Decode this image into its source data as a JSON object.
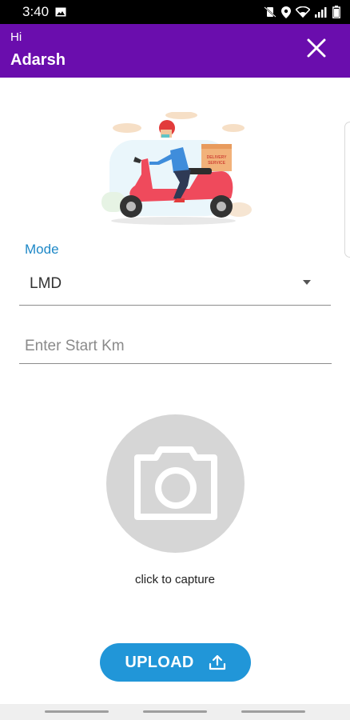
{
  "status_bar": {
    "time": "3:40",
    "icons": [
      "image-icon",
      "mute-vibrate-icon",
      "location-icon",
      "wifi-icon",
      "signal-icon",
      "battery-icon"
    ]
  },
  "header": {
    "greeting": "Hi",
    "user_name": "Adarsh",
    "close_icon": "close-icon",
    "background_color": "#6a0dad"
  },
  "illustration": {
    "box_text_line1": "DELIVERY",
    "box_text_line2": "SERVICE"
  },
  "form": {
    "mode_label": "Mode",
    "mode_value": "LMD",
    "start_km_placeholder": "Enter Start Km",
    "start_km_value": ""
  },
  "capture": {
    "label": "click to capture",
    "icon": "camera-icon"
  },
  "upload": {
    "label": "UPLOAD",
    "icon": "upload-icon",
    "color": "#2196d8"
  }
}
